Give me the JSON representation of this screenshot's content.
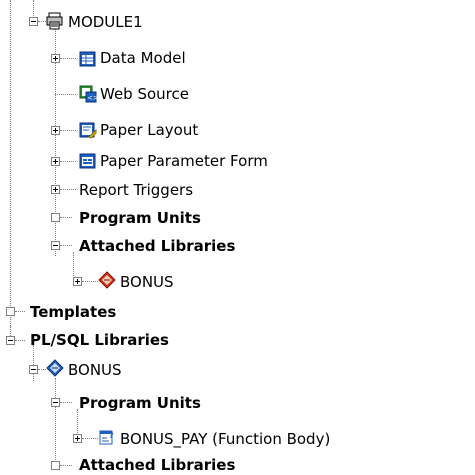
{
  "tree": {
    "module1": "MODULE1",
    "data_model": "Data Model",
    "web_source": "Web Source",
    "paper_layout": "Paper Layout",
    "paper_param_form": "Paper Parameter Form",
    "report_triggers": "Report Triggers",
    "program_units_1": "Program Units",
    "attached_libraries_1": "Attached Libraries",
    "bonus_attached": "BONUS",
    "templates": "Templates",
    "plsql_libraries": "PL/SQL Libraries",
    "bonus_lib": "BONUS",
    "program_units_2": "Program Units",
    "bonus_pay": "BONUS_PAY (Function Body)",
    "attached_libraries_2": "Attached Libraries"
  },
  "colors": {
    "tree_line": "#808080",
    "selection": "none"
  }
}
